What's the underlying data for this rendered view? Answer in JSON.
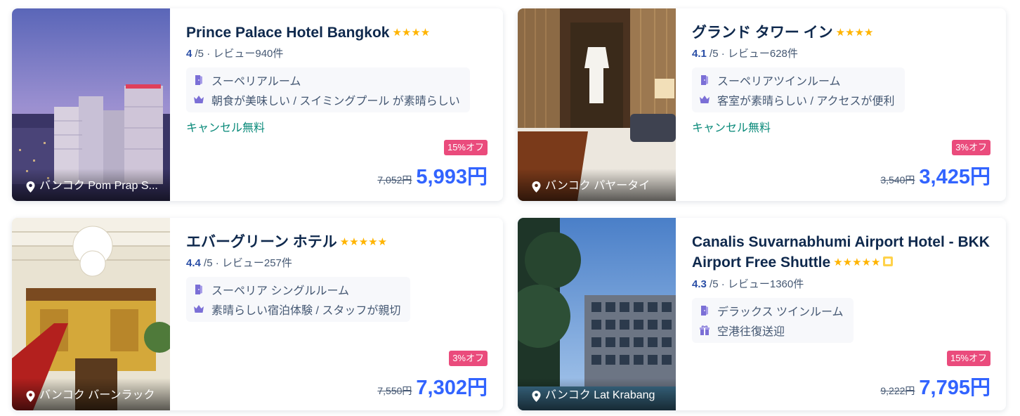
{
  "colors": {
    "accent_price": "#3264ff",
    "discount_bg": "#ea4b7c",
    "star": "#ffb400",
    "cancel_text": "#0a8a7a",
    "rating_score": "#2a4ea6"
  },
  "hotels": [
    {
      "name": "Prince Palace Hotel Bangkok",
      "stars": "★★★★",
      "star_count": 4,
      "score": "4",
      "rating_suffix": " /5 · レビュー940件",
      "room": "スーペリアルーム",
      "highlight": "朝食が美味しい / スイミングプール が素晴らしい",
      "free_cancel": "キャンセル無料",
      "discount": "15%オフ",
      "old_price": "7,052円",
      "price": "5,993円",
      "location": "バンコク Pom Prap S...",
      "room_icon": "door-icon",
      "highlight_icon": "crown-icon"
    },
    {
      "name": "グランド タワー イン",
      "stars": "★★★★",
      "star_count": 4,
      "score": "4.1",
      "rating_suffix": " /5 · レビュー628件",
      "room": "スーペリアツインルーム",
      "highlight": "客室が素晴らしい / アクセスが便利",
      "free_cancel": "キャンセル無料",
      "discount": "3%オフ",
      "old_price": "3,540円",
      "price": "3,425円",
      "location": "バンコク パヤータイ",
      "room_icon": "door-icon",
      "highlight_icon": "crown-icon"
    },
    {
      "name": "エバーグリーン ホテル",
      "stars": "★★★★★",
      "star_count": 5,
      "score": "4.4",
      "rating_suffix": " /5 · レビュー257件",
      "room": "スーペリア シングルルーム",
      "highlight": "素晴らしい宿泊体験 / スタッフが親切",
      "discount": "3%オフ",
      "old_price": "7,550円",
      "price": "7,302円",
      "location": "バンコク バーンラック",
      "room_icon": "door-icon",
      "highlight_icon": "crown-icon"
    },
    {
      "name": "Canalis Suvarnabhumi Airport Hotel - BKK Airport Free Shuttle",
      "stars": "★★★★★",
      "star_count": 5,
      "score": "4.3",
      "rating_suffix": " /5 · レビュー1360件",
      "room": "デラックス ツインルーム",
      "highlight": "空港往復送迎",
      "discount": "15%オフ",
      "old_price": "9,222円",
      "price": "7,795円",
      "location": "バンコク Lat Krabang",
      "room_icon": "door-icon",
      "highlight_icon": "gift-icon"
    }
  ]
}
